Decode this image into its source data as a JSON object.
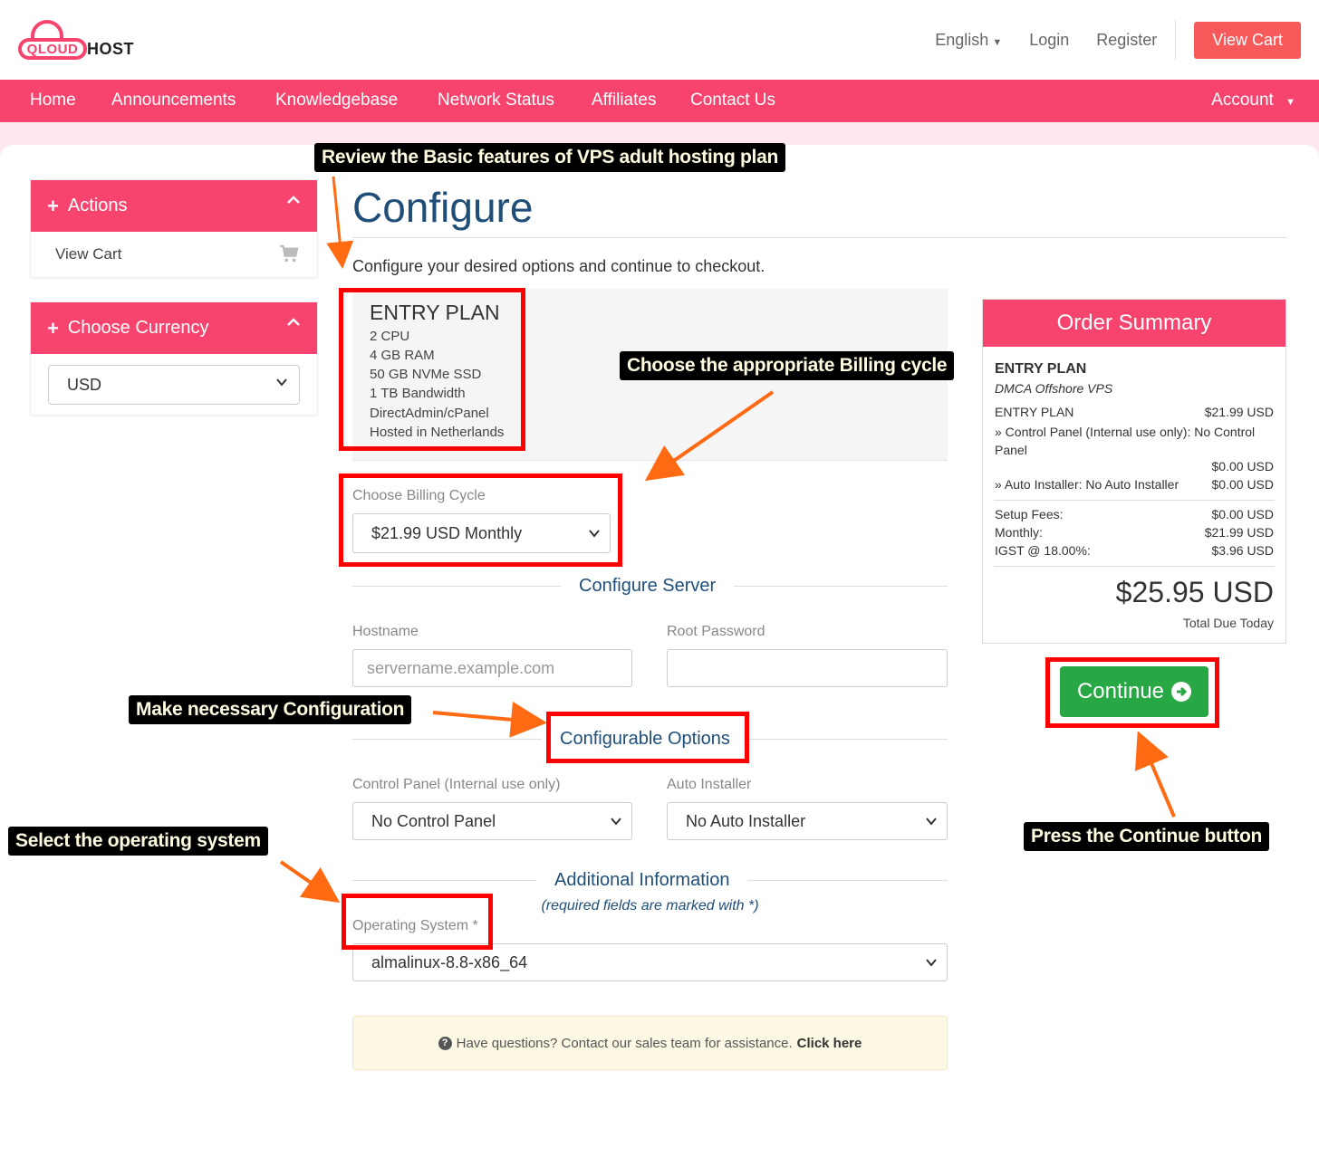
{
  "brand": {
    "logo_cloud_text": "QLOUD",
    "logo_host_text": "HOST"
  },
  "top_links": {
    "language": "English",
    "login": "Login",
    "register": "Register",
    "view_cart": "View Cart"
  },
  "nav": {
    "items": [
      "Home",
      "Announcements",
      "Knowledgebase",
      "Network Status",
      "Affiliates",
      "Contact Us"
    ],
    "account": "Account"
  },
  "sidebar": {
    "actions_title": "Actions",
    "view_cart": "View Cart",
    "currency_title": "Choose Currency",
    "currency_value": "USD"
  },
  "main": {
    "title": "Configure",
    "subtitle": "Configure your desired options and continue to checkout.",
    "plan": {
      "name": "ENTRY PLAN",
      "features": [
        "2 CPU",
        "4 GB RAM",
        "50 GB NVMe SSD",
        "1 TB Bandwidth",
        "DirectAdmin/cPanel",
        "Hosted in Netherlands"
      ]
    },
    "billing_label": "Choose Billing Cycle",
    "billing_value": "$21.99 USD Monthly",
    "configure_server_title": "Configure Server",
    "hostname_label": "Hostname",
    "hostname_placeholder": "servername.example.com",
    "root_password_label": "Root Password",
    "configurable_options_title": "Configurable Options",
    "control_panel_label": "Control Panel (Internal use only)",
    "control_panel_value": "No Control Panel",
    "auto_installer_label": "Auto Installer",
    "auto_installer_value": "No Auto Installer",
    "additional_info_title": "Additional Information",
    "required_note": "(required fields are marked with *)",
    "os_label": "Operating System *",
    "os_value": "almalinux-8.8-x86_64",
    "help_text": "Have questions? Contact our sales team for assistance.",
    "help_link": "Click here"
  },
  "summary": {
    "title": "Order Summary",
    "product": "ENTRY PLAN",
    "group": "DMCA Offshore VPS",
    "line1_label": "ENTRY PLAN",
    "line1_value": "$21.99 USD",
    "line2_label": "» Control Panel (Internal use only): No Control Panel",
    "line2_value": "$0.00 USD",
    "line3_label": "» Auto Installer: No Auto Installer",
    "line3_value": "$0.00 USD",
    "setup_label": "Setup Fees:",
    "setup_value": "$0.00 USD",
    "monthly_label": "Monthly:",
    "monthly_value": "$21.99 USD",
    "tax_label": "IGST @ 18.00%:",
    "tax_value": "$3.96 USD",
    "total": "$25.95 USD",
    "total_label": "Total Due Today",
    "continue": "Continue"
  },
  "annotations": {
    "review": "Review the Basic features of VPS adult hosting plan",
    "billing": "Choose the appropriate Billing cycle",
    "configure": "Make necessary Configuration",
    "os": "Select the operating system",
    "continue": "Press the Continue button"
  },
  "colors": {
    "brand_pink": "#f6446e",
    "heading_blue": "#1f4e79",
    "continue_green": "#28a745",
    "annotation_red": "#ff0000",
    "arrow_orange": "#ff6a13"
  }
}
